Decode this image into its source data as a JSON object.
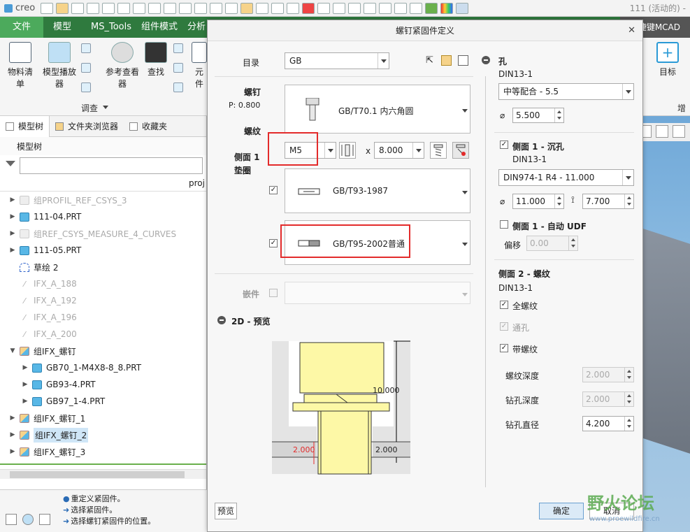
{
  "app": {
    "logo": "creo",
    "window_title": "111 (活动的) -"
  },
  "ribbon_tabs": [
    "文件",
    "模型",
    "MS_Tools",
    "组件模式",
    "分析",
    "快捷键MCAD"
  ],
  "ribbon": {
    "bom": "物料清单",
    "model_player": "模型播放器",
    "ref_viewer": "参考查看器",
    "find": "查找",
    "element": "元件",
    "investigate": "调查",
    "target": "目标",
    "enhance": "增强"
  },
  "left_pane": {
    "tabs": [
      "模型树",
      "文件夹浏览器",
      "收藏夹"
    ],
    "tree_header": "模型树",
    "column": "proj",
    "items": [
      {
        "label": "组PROFIL_REF_CSYS_3",
        "icon": "faded",
        "dim": true,
        "toggle": "▶",
        "indent": 1
      },
      {
        "label": "111-04.PRT",
        "icon": "part",
        "dim": false,
        "toggle": "▶",
        "indent": 1
      },
      {
        "label": "组REF_CSYS_MEASURE_4_CURVES",
        "icon": "faded",
        "dim": true,
        "toggle": "▶",
        "indent": 1
      },
      {
        "label": "111-05.PRT",
        "icon": "part",
        "dim": false,
        "toggle": "▶",
        "indent": 1
      },
      {
        "label": "草绘 2",
        "icon": "sketch",
        "dim": false,
        "toggle": "",
        "indent": 1
      },
      {
        "label": "IFX_A_188",
        "icon": "ifx",
        "dim": true,
        "toggle": "",
        "indent": 1
      },
      {
        "label": "IFX_A_192",
        "icon": "ifx",
        "dim": true,
        "toggle": "",
        "indent": 1
      },
      {
        "label": "IFX_A_196",
        "icon": "ifx",
        "dim": true,
        "toggle": "",
        "indent": 1
      },
      {
        "label": "IFX_A_200",
        "icon": "ifx",
        "dim": true,
        "toggle": "",
        "indent": 1
      },
      {
        "label": "组IFX_螺钉",
        "icon": "asm",
        "dim": false,
        "toggle": "▼",
        "indent": 1
      },
      {
        "label": "GB70_1-M4X8-8_8.PRT",
        "icon": "part",
        "dim": false,
        "toggle": "▶",
        "indent": 2
      },
      {
        "label": "GB93-4.PRT",
        "icon": "part",
        "dim": false,
        "toggle": "▶",
        "indent": 2
      },
      {
        "label": "GB97_1-4.PRT",
        "icon": "part",
        "dim": false,
        "toggle": "▶",
        "indent": 2
      },
      {
        "label": "组IFX_螺钉_1",
        "icon": "asm",
        "dim": false,
        "toggle": "▶",
        "indent": 1
      },
      {
        "label": "组IFX_螺钉_2",
        "icon": "asm",
        "dim": false,
        "toggle": "▶",
        "indent": 1,
        "selected": true
      },
      {
        "label": "组IFX_螺钉_3",
        "icon": "asm",
        "dim": false,
        "toggle": "▶",
        "indent": 1
      }
    ]
  },
  "status_messages": [
    "重定义紧固件。",
    "选择紧固件。",
    "选择螺钉紧固件的位置。"
  ],
  "dialog": {
    "title": "螺钉紧固件定义",
    "catalog_label": "目录",
    "catalog_value": "GB",
    "screw_label": "螺钉",
    "pitch": "P: 0.800",
    "screw_name": "GB/T70.1 内六角圆",
    "thread_label": "螺纹",
    "thread_size": "M5",
    "times": "x",
    "length": "8.000",
    "side1_label": "侧面 1",
    "washer_label": "垫圈",
    "washer1": "GB/T93-1987",
    "washer2": "GB/T95-2002普通",
    "insert_label": "嵌件",
    "preview_label": "2D - 预览",
    "preview_button": "预览",
    "dims": {
      "total": "10.000",
      "left": "2.000",
      "right": "2.000"
    },
    "hole": {
      "title": "孔",
      "std": "DIN13-1",
      "fit": "中等配合 - 5.5",
      "diameter": "5.500",
      "cbore_label": "侧面 1 - 沉孔",
      "cbore_std": "DIN13-1",
      "cbore_spec": "DIN974-1 R4 - 11.000",
      "cbore_dia": "11.000",
      "cbore_depth": "7.700",
      "udf_label": "侧面 1 - 自动 UDF",
      "offset_label": "偏移",
      "offset_value": "0.00",
      "side2_label": "侧面 2 - 螺纹",
      "side2_std": "DIN13-1",
      "full_thread": "全螺纹",
      "through": "通孔",
      "with_thread": "带螺纹",
      "thread_depth_label": "螺纹深度",
      "thread_depth": "2.000",
      "drill_depth_label": "钻孔深度",
      "drill_depth": "2.000",
      "drill_dia_label": "钻孔直径",
      "drill_dia": "4.200"
    },
    "ok": "确定",
    "cancel": "取消"
  },
  "watermark": {
    "main": "野火论坛",
    "url": "www.proewildfire.cn"
  },
  "colors": {
    "ribbon_green": "#2f7a3e",
    "highlight_red": "#e32b2b",
    "part_yellow": "#fdf8a6"
  }
}
